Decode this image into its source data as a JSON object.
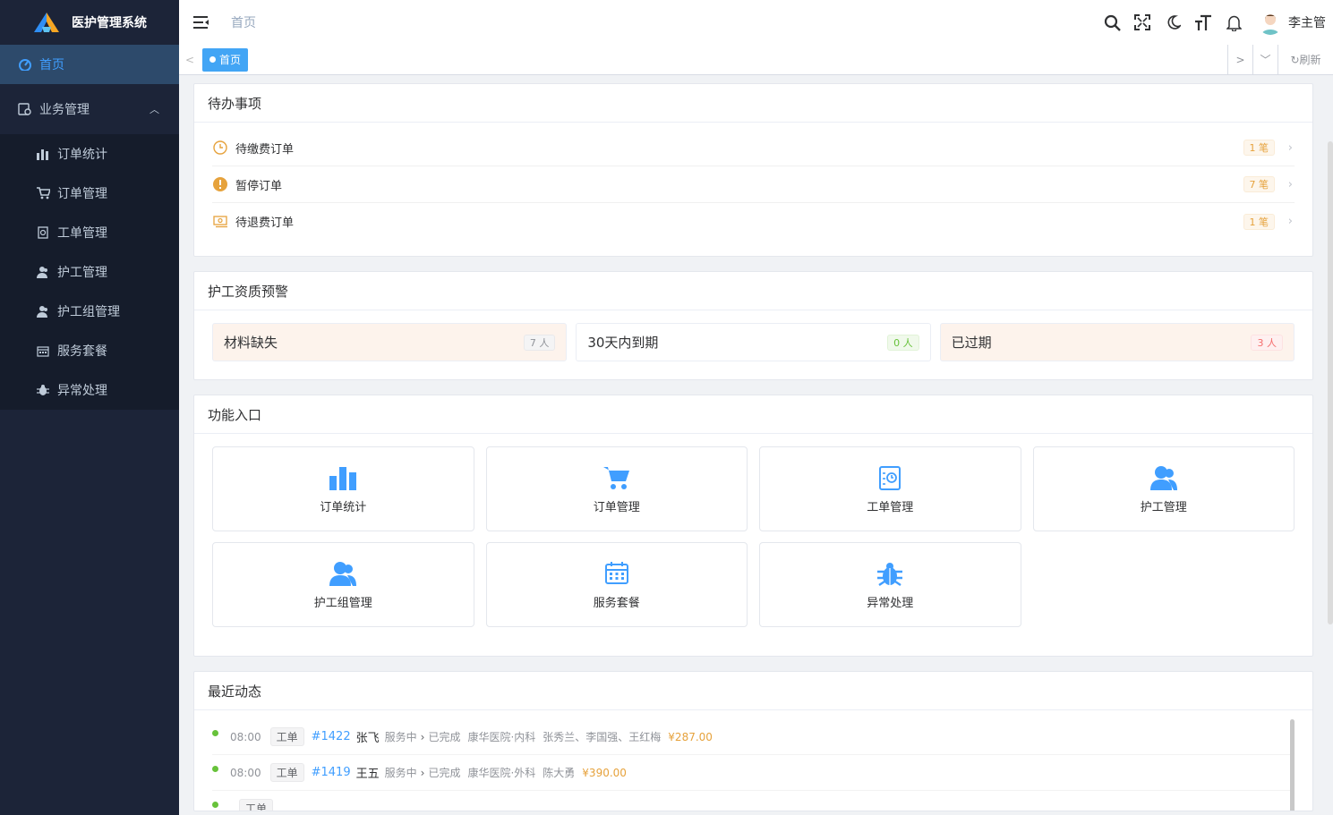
{
  "app": {
    "title": "医护管理系统"
  },
  "sidebar": {
    "home": {
      "label": "首页",
      "icon": "dashboard-icon"
    },
    "group": {
      "label": "业务管理",
      "icon": "briefcase-icon"
    },
    "items": [
      {
        "label": "订单统计",
        "icon": "bar-chart-icon"
      },
      {
        "label": "订单管理",
        "icon": "cart-icon"
      },
      {
        "label": "工单管理",
        "icon": "clipboard-icon"
      },
      {
        "label": "护工管理",
        "icon": "user-icon"
      },
      {
        "label": "护工组管理",
        "icon": "users-icon"
      },
      {
        "label": "服务套餐",
        "icon": "calendar-icon"
      },
      {
        "label": "异常处理",
        "icon": "bug-icon"
      }
    ]
  },
  "navbar": {
    "breadcrumb": "首页",
    "username": "李主管",
    "icons": [
      "search-icon",
      "fullscreen-icon",
      "dark-mode-icon",
      "font-size-icon",
      "bell-icon"
    ]
  },
  "tags": {
    "active": "首页",
    "refresh": "刷新"
  },
  "todo": {
    "title": "待办事项",
    "items": [
      {
        "label": "待缴费订单",
        "count": "1 笔",
        "icon": "clock-icon"
      },
      {
        "label": "暂停订单",
        "count": "7 笔",
        "icon": "warning-icon"
      },
      {
        "label": "待退费订单",
        "count": "1 笔",
        "icon": "refund-icon"
      }
    ]
  },
  "warning": {
    "title": "护工资质预警",
    "items": [
      {
        "label": "材料缺失",
        "count": "7 人",
        "color": "#909399"
      },
      {
        "label": "30天内到期",
        "count": "0 人",
        "color": "#67c23a"
      },
      {
        "label": "已过期",
        "count": "3 人",
        "color": "#f56c6c"
      }
    ]
  },
  "functions": {
    "title": "功能入口",
    "items": [
      {
        "label": "订单统计",
        "icon": "bar-chart-icon"
      },
      {
        "label": "订单管理",
        "icon": "cart-icon"
      },
      {
        "label": "工单管理",
        "icon": "clipboard-icon"
      },
      {
        "label": "护工管理",
        "icon": "user-icon"
      },
      {
        "label": "护工组管理",
        "icon": "users-icon"
      },
      {
        "label": "服务套餐",
        "icon": "calendar-icon"
      },
      {
        "label": "异常处理",
        "icon": "bug-icon"
      }
    ]
  },
  "activity": {
    "title": "最近动态",
    "items": [
      {
        "time": "08:00",
        "type": "工单",
        "id": "#1422",
        "name": "张飞",
        "from": "服务中",
        "to": "已完成",
        "hospital": "康华医院·内科",
        "staff": "张秀兰、李国强、王红梅",
        "price": "¥287.00"
      },
      {
        "time": "08:00",
        "type": "工单",
        "id": "#1419",
        "name": "王五",
        "from": "服务中",
        "to": "已完成",
        "hospital": "康华医院·外科",
        "staff": "陈大勇",
        "price": "¥390.00"
      },
      {
        "time": "",
        "type": "工单",
        "id": "",
        "name": "",
        "from": "",
        "to": "",
        "hospital": "",
        "staff": "",
        "price": ""
      }
    ]
  },
  "colors": {
    "accent": "#409eff",
    "sidebar": "#1c2438",
    "warning": "#e6a23c"
  }
}
